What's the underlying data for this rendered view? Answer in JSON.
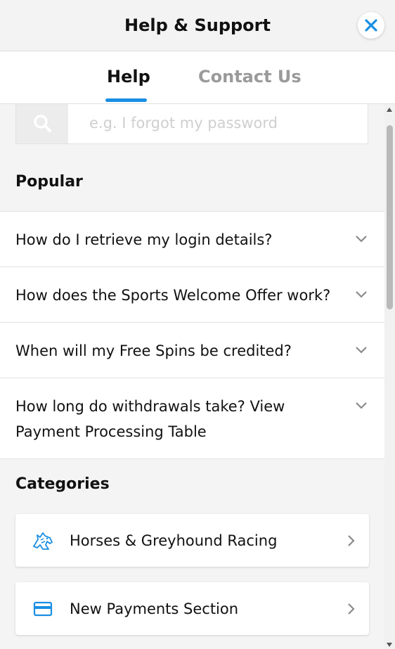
{
  "header": {
    "title": "Help & Support",
    "close_icon": "close-icon"
  },
  "tabs": [
    {
      "label": "Help",
      "active": true
    },
    {
      "label": "Contact Us",
      "active": false
    }
  ],
  "search": {
    "placeholder": "e.g. I forgot my password",
    "value": "",
    "icon": "search-icon"
  },
  "popular": {
    "title": "Popular",
    "items": [
      {
        "label": "How do I retrieve my login details?"
      },
      {
        "label": "How does the Sports Welcome Offer work?"
      },
      {
        "label": "When will my Free Spins be credited?"
      },
      {
        "label": "How long do withdrawals take? View Payment Processing Table"
      }
    ]
  },
  "categories": {
    "title": "Categories",
    "items": [
      {
        "label": "Horses & Greyhound Racing",
        "icon": "horse-head-icon"
      },
      {
        "label": "New Payments Section",
        "icon": "credit-card-icon"
      }
    ]
  },
  "colors": {
    "accent": "#1a8fe3",
    "inactive_tab": "#9a9a9a",
    "background": "#f4f4f4"
  }
}
